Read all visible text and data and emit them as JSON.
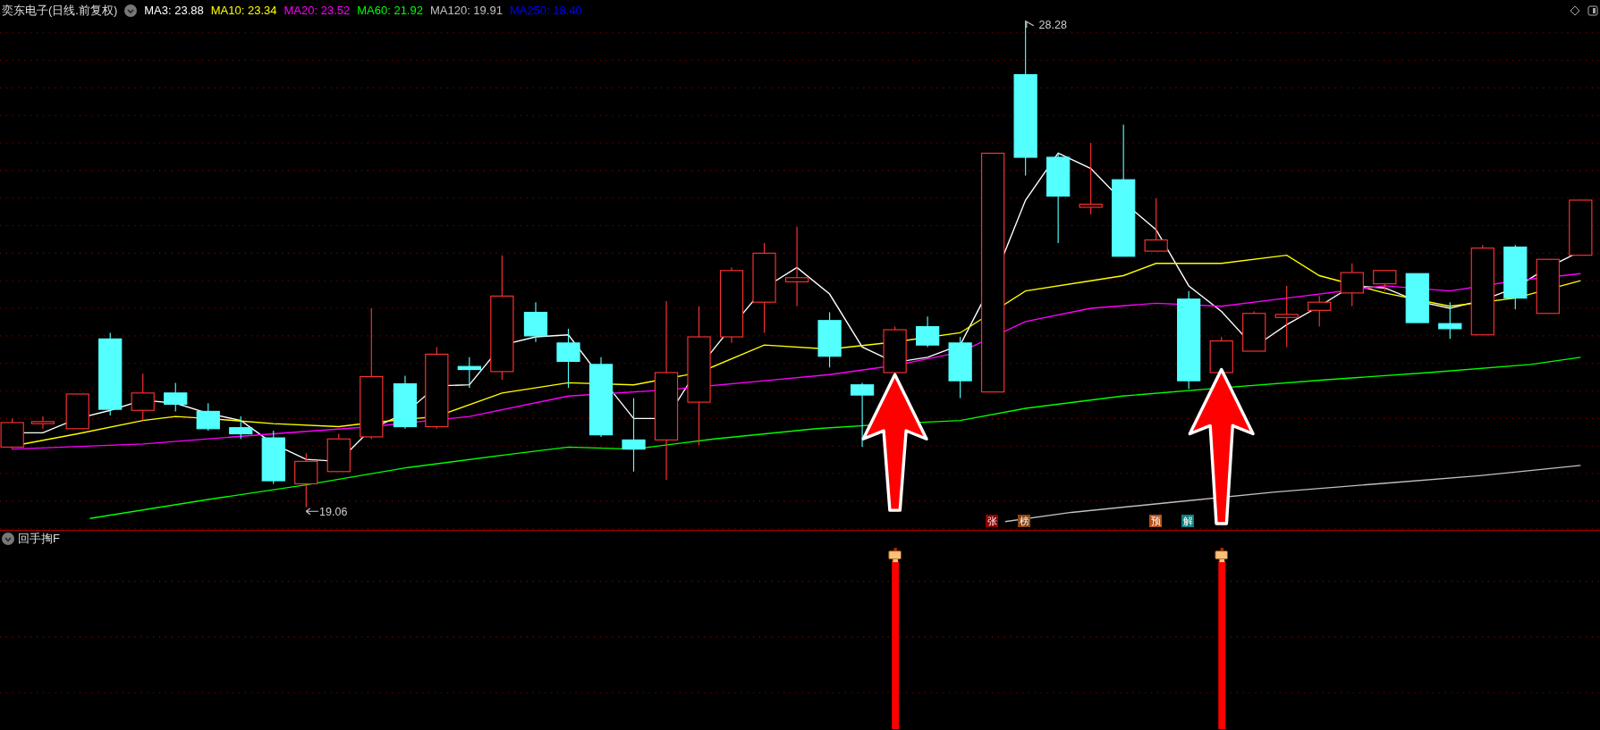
{
  "header": {
    "title": "奕东电子(日线.前复权)",
    "moving_averages": [
      {
        "label": "MA3: 23.88",
        "color": "#ffffff"
      },
      {
        "label": "MA10: 23.34",
        "color": "#ffff00"
      },
      {
        "label": "MA20: 23.52",
        "color": "#ff00ff"
      },
      {
        "label": "MA60: 21.92",
        "color": "#00ff00"
      },
      {
        "label": "MA120: 19.91",
        "color": "#c0c0c0"
      },
      {
        "label": "MA250: 18.40",
        "color": "#0000ff"
      }
    ]
  },
  "main_chart": {
    "high_label": "28.28",
    "low_label": "19.06",
    "markers": [
      {
        "text": "张",
        "color": "#8b0000"
      },
      {
        "text": "榜",
        "color": "#8b4513"
      },
      {
        "text": "预",
        "color": "#b5501a"
      },
      {
        "text": "解",
        "color": "#108080"
      }
    ]
  },
  "indicator_panel": {
    "title": "回手掏F"
  }
}
